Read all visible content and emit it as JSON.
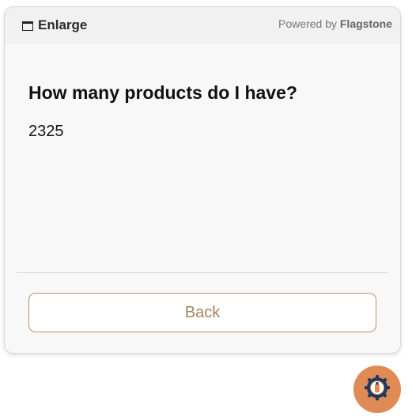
{
  "header": {
    "enlarge_label": "Enlarge",
    "powered_prefix": "Powered by",
    "powered_brand": "Flagstone"
  },
  "main": {
    "question": "How many products do I have?",
    "answer": "2325"
  },
  "footer": {
    "back_label": "Back"
  },
  "icons": {
    "enlarge": "window-icon",
    "fab": "gear-assistant-icon"
  },
  "colors": {
    "accent": "#b98f6f",
    "fab_bg": "#e08a55",
    "fab_ring": "#1e3a5f"
  }
}
